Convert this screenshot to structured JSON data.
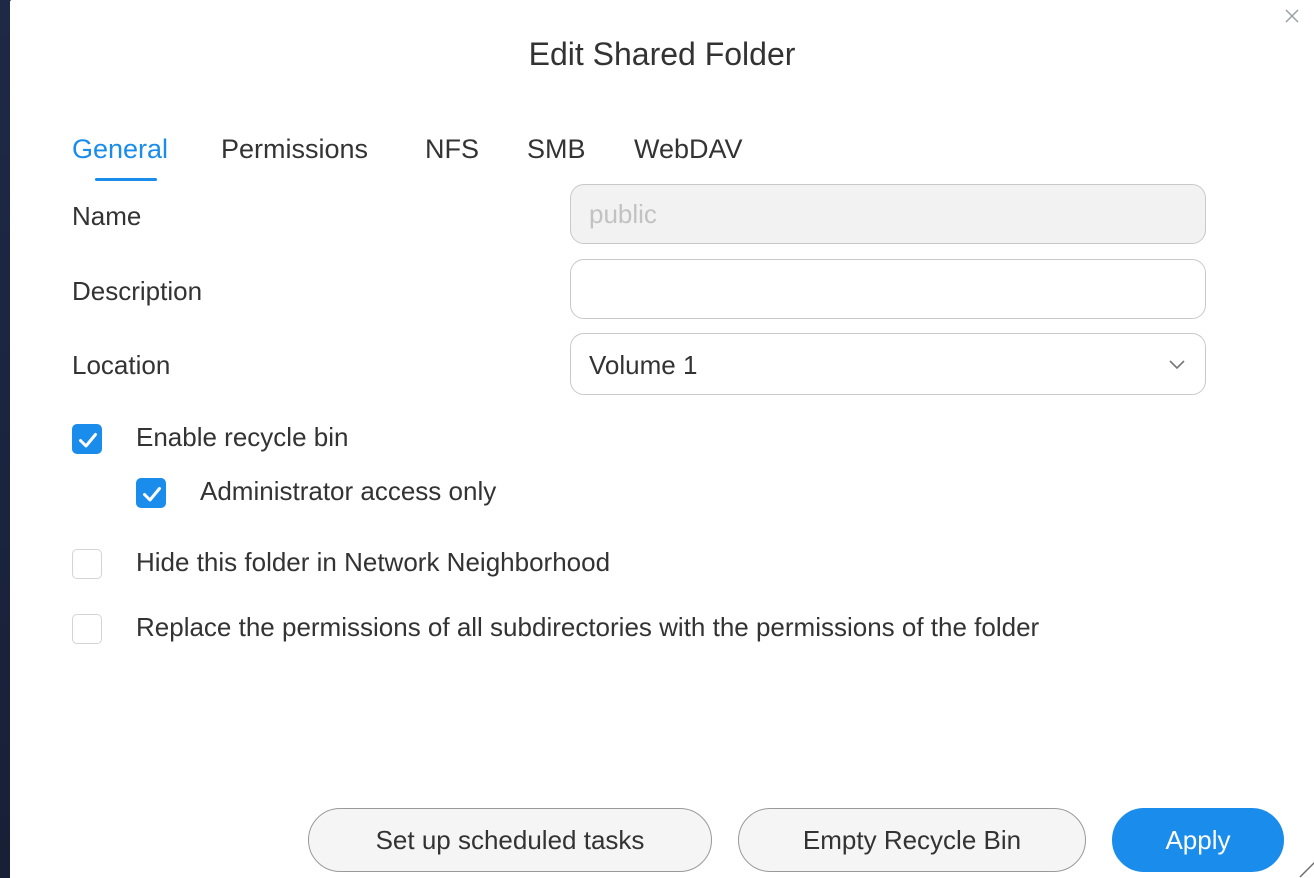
{
  "dialog": {
    "title": "Edit Shared Folder",
    "close_icon": "close-icon"
  },
  "tabs": [
    {
      "label": "General",
      "active": true
    },
    {
      "label": "Permissions",
      "active": false
    },
    {
      "label": "NFS",
      "active": false
    },
    {
      "label": "SMB",
      "active": false
    },
    {
      "label": "WebDAV",
      "active": false
    }
  ],
  "form": {
    "name": {
      "label": "Name",
      "value": "public",
      "disabled": true
    },
    "description": {
      "label": "Description",
      "value": ""
    },
    "location": {
      "label": "Location",
      "value": "Volume 1",
      "icon": "chevron-down-icon"
    }
  },
  "options": [
    {
      "label": "Enable recycle bin",
      "checked": true
    },
    {
      "label": "Administrator access only",
      "checked": true
    },
    {
      "label": "Hide this folder in Network Neighborhood",
      "checked": false
    },
    {
      "label": "Replace the permissions of all subdirectories with the permissions of the folder",
      "checked": false
    }
  ],
  "buttons": {
    "scheduled_tasks": "Set up scheduled tasks",
    "empty_recycle_bin": "Empty Recycle Bin",
    "apply": "Apply"
  },
  "colors": {
    "accent": "#1a8ceb",
    "text": "#333333",
    "border": "#c9c9c9",
    "backdrop": "#1a2238"
  }
}
